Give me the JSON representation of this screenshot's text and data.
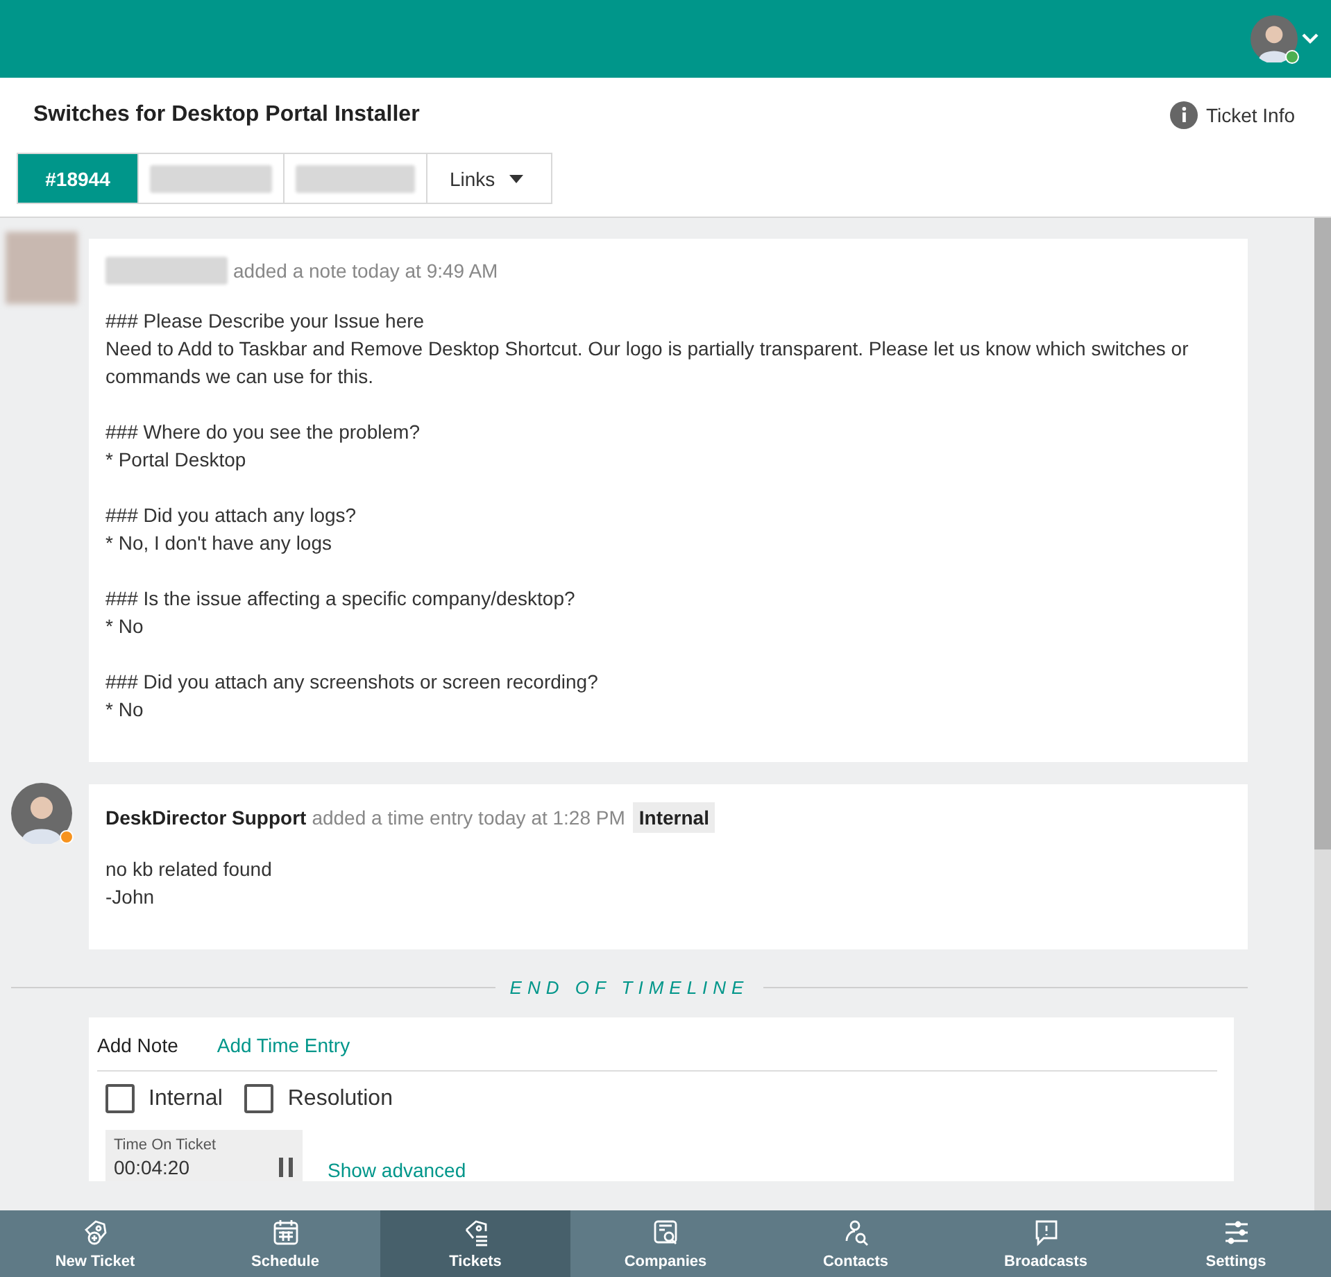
{
  "header": {
    "user": {
      "color": "#4caf50"
    }
  },
  "ticket": {
    "title": "Switches for Desktop Portal Installer",
    "info_label": "Ticket Info",
    "tabs": [
      {
        "kind": "label",
        "label": "#18944",
        "selected": true
      },
      {
        "kind": "redacted",
        "selected": false
      },
      {
        "kind": "redacted",
        "selected": false
      },
      {
        "kind": "dropdown",
        "label": "Links",
        "selected": false
      }
    ]
  },
  "timeline": [
    {
      "kind": "note",
      "action": "added a note today at 9:49 AM",
      "paragraphs": [
        [
          "### Please Describe your Issue here",
          "Need to Add to Taskbar and Remove Desktop Shortcut. Our logo is partially transparent. Please let us know which switches or commands we can use for this."
        ],
        [
          "### Where do you see the problem?",
          "* Portal Desktop"
        ],
        [
          "### Did you attach any logs?",
          "* No, I don't have any logs"
        ],
        [
          "### Is the issue affecting a specific company/desktop?",
          "* No"
        ],
        [
          "### Did you attach any screenshots or screen recording?",
          "* No"
        ]
      ]
    },
    {
      "kind": "time_entry",
      "author": "DeskDirector Support",
      "color": "#f7931e",
      "action": "added a time entry today at 1:28 PM",
      "badge": "Internal",
      "paragraphs": [
        [
          "no kb related found",
          "-John"
        ]
      ]
    }
  ],
  "end_label": "END OF TIMELINE",
  "composer": {
    "tabs": [
      {
        "label": "Add Note",
        "selected": true
      },
      {
        "label": "Add Time Entry",
        "selected": false
      }
    ],
    "options": [
      {
        "label": "Internal",
        "checked": false
      },
      {
        "label": "Resolution",
        "checked": false
      }
    ],
    "timer": {
      "label": "Time On Ticket",
      "value": "00:04:20"
    },
    "advanced_link": "Show advanced"
  },
  "nav": [
    {
      "kind": "new_ticket",
      "label": "New Ticket",
      "selected": false
    },
    {
      "kind": "schedule",
      "label": "Schedule",
      "selected": false
    },
    {
      "kind": "tickets",
      "label": "Tickets",
      "selected": true
    },
    {
      "kind": "companies",
      "label": "Companies",
      "selected": false
    },
    {
      "kind": "contacts",
      "label": "Contacts",
      "selected": false
    },
    {
      "kind": "broadcasts",
      "label": "Broadcasts",
      "selected": false
    },
    {
      "kind": "settings",
      "label": "Settings",
      "selected": false
    }
  ]
}
